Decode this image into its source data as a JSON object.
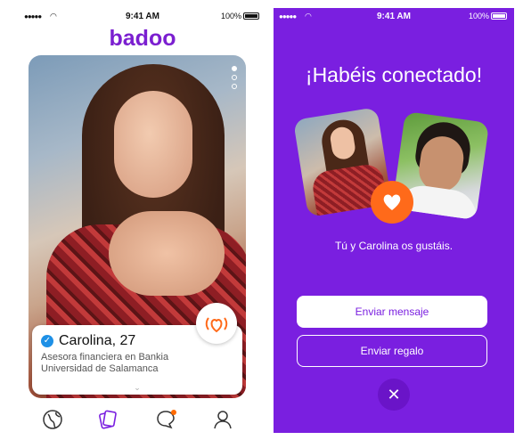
{
  "left": {
    "status": {
      "time": "9:41 AM",
      "battery": "100%"
    },
    "app_logo": "badoo",
    "profile": {
      "name": "Carolina, 27",
      "job": "Asesora financiera en Bankia",
      "education": "Universidad de Salamanca"
    },
    "tabs": [
      "globe-icon",
      "cards-icon",
      "chat-icon",
      "profile-icon"
    ]
  },
  "right": {
    "status": {
      "time": "9:41 AM",
      "battery": "100%"
    },
    "title": "¡Habéis conectado!",
    "subtitle": "Tú y Carolina os gustáis.",
    "primary_button": "Enviar mensaje",
    "secondary_button": "Enviar regalo",
    "close_symbol": "✕"
  },
  "colors": {
    "brand_purple": "#7a1fe0",
    "accent_orange": "#ff6a1a",
    "verified_blue": "#1e90e6"
  }
}
